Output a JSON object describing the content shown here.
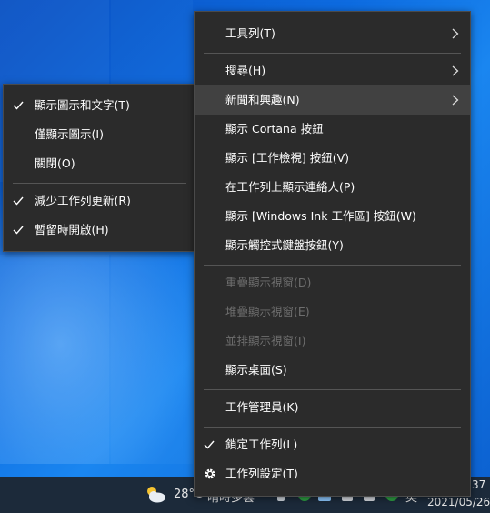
{
  "main_menu": [
    {
      "label": "工具列(T)",
      "submenu": true
    },
    {
      "label": "搜尋(H)",
      "submenu": true
    },
    {
      "label": "新聞和興趣(N)",
      "submenu": true,
      "highlighted": true
    },
    {
      "label": "顯示 Cortana 按鈕"
    },
    {
      "label": "顯示 [工作檢視] 按鈕(V)"
    },
    {
      "label": "在工作列上顯示連絡人(P)"
    },
    {
      "label": "顯示 [Windows Ink 工作區] 按鈕(W)"
    },
    {
      "label": "顯示觸控式鍵盤按鈕(Y)"
    },
    {
      "label": "重疊顯示視窗(D)",
      "disabled": true
    },
    {
      "label": "堆疊顯示視窗(E)",
      "disabled": true
    },
    {
      "label": "並排顯示視窗(I)",
      "disabled": true
    },
    {
      "label": "顯示桌面(S)"
    },
    {
      "label": "工作管理員(K)"
    },
    {
      "label": "鎖定工作列(L)",
      "checked": true
    },
    {
      "label": "工作列設定(T)",
      "icon": "gear-icon"
    }
  ],
  "sub_menu": [
    {
      "label": "顯示圖示和文字(T)",
      "checked": true
    },
    {
      "label": "僅顯示圖示(I)"
    },
    {
      "label": "關閉(O)"
    },
    {
      "label": "減少工作列更新(R)",
      "checked": true
    },
    {
      "label": "暫留時開啟(H)",
      "checked": true
    }
  ],
  "taskbar": {
    "weather_icon": "cloud-sun-icon",
    "temperature": "28°C",
    "weather_text": "晴時多雲",
    "time": "37",
    "date": "2021/05/26",
    "ime": "英"
  }
}
